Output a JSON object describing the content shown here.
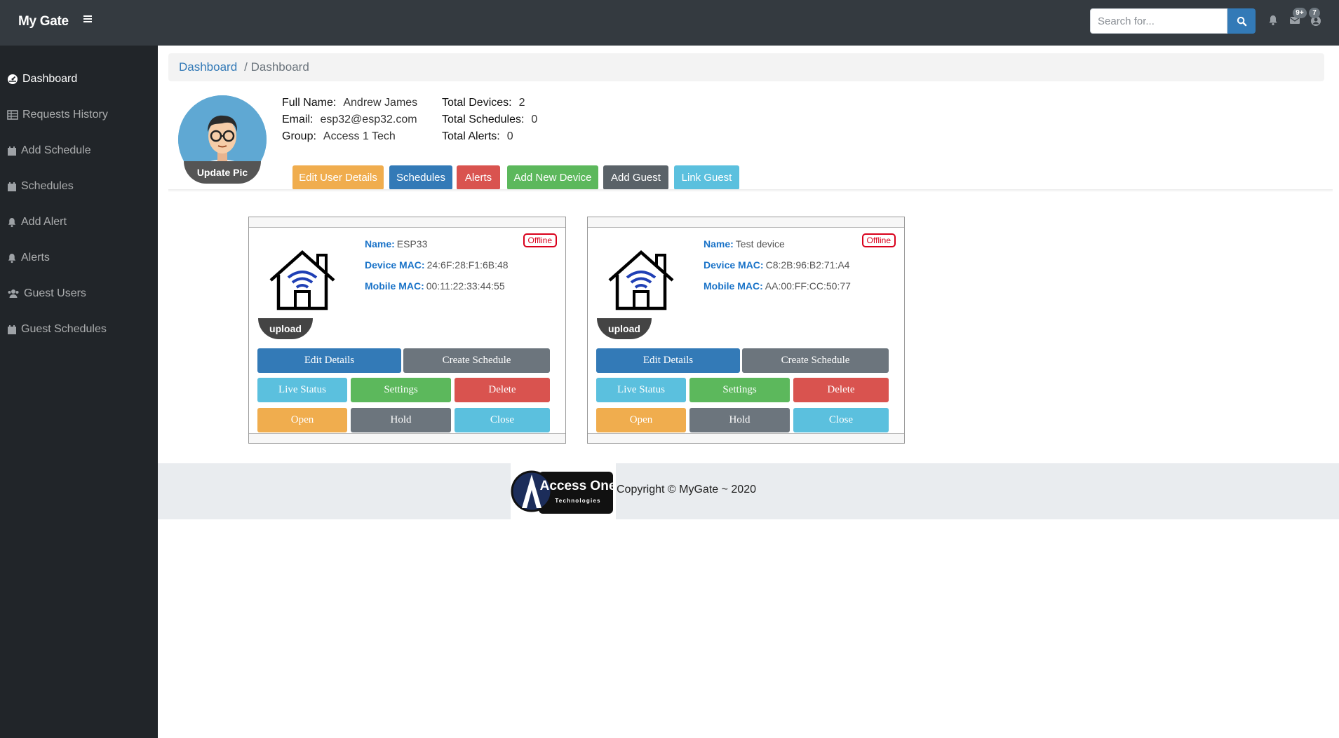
{
  "topbar": {
    "brand": "My Gate",
    "search_placeholder": "Search for...",
    "alerts_badge": "9+",
    "messages_badge": "7"
  },
  "sidebar": {
    "items": [
      {
        "label": "Dashboard",
        "icon": "dashboard-icon"
      },
      {
        "label": "Requests History",
        "icon": "table-icon"
      },
      {
        "label": "Add Schedule",
        "icon": "calendar-icon"
      },
      {
        "label": "Schedules",
        "icon": "calendar-icon"
      },
      {
        "label": "Add Alert",
        "icon": "bell-icon"
      },
      {
        "label": "Alerts",
        "icon": "bell-icon"
      },
      {
        "label": "Guest Users",
        "icon": "users-icon"
      },
      {
        "label": "Guest Schedules",
        "icon": "calendar-icon"
      }
    ]
  },
  "breadcrumb": {
    "link": "Dashboard",
    "current": "/ Dashboard"
  },
  "profile": {
    "update_pic": "Update Pic",
    "full_name_label": "Full Name:",
    "full_name": "Andrew James",
    "email_label": "Email:",
    "email": "esp32@esp32.com",
    "group_label": "Group:",
    "group": "Access 1 Tech",
    "total_devices_label": "Total Devices:",
    "total_devices": "2",
    "total_schedules_label": "Total Schedules:",
    "total_schedules": "0",
    "total_alerts_label": "Total Alerts:",
    "total_alerts": "0"
  },
  "actions": {
    "edit_user": "Edit User Details",
    "schedules": "Schedules",
    "alerts": "Alerts",
    "add_device": "Add New Device",
    "add_guest": "Add Guest",
    "link_guest": "Link Guest"
  },
  "devices": [
    {
      "status": "Offline",
      "name_label": "Name:",
      "name": "ESP33",
      "device_mac_label": "Device MAC:",
      "device_mac": "24:6F:28:F1:6B:48",
      "mobile_mac_label": "Mobile MAC:",
      "mobile_mac": "00:11:22:33:44:55",
      "upload": "upload",
      "edit": "Edit Details",
      "create_schedule": "Create Schedule",
      "live_status": "Live Status",
      "settings": "Settings",
      "delete": "Delete",
      "open": "Open",
      "hold": "Hold",
      "close": "Close"
    },
    {
      "status": "Offline",
      "name_label": "Name:",
      "name": "Test device",
      "device_mac_label": "Device MAC:",
      "device_mac": "C8:2B:96:B2:71:A4",
      "mobile_mac_label": "Mobile MAC:",
      "mobile_mac": "AA:00:FF:CC:50:77",
      "upload": "upload",
      "edit": "Edit Details",
      "create_schedule": "Create Schedule",
      "live_status": "Live Status",
      "settings": "Settings",
      "delete": "Delete",
      "open": "Open",
      "hold": "Hold",
      "close": "Close"
    }
  ],
  "footer": {
    "logo_title": "Access One",
    "logo_sub": "Technologies",
    "copyright": "Copyright © MyGate ~ 2020"
  }
}
